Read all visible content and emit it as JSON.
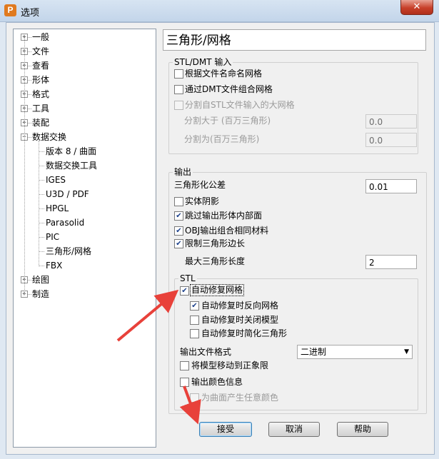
{
  "window": {
    "icon_letter": "P",
    "title": "选项",
    "close_glyph": "✕"
  },
  "tree": {
    "items": [
      {
        "label": "一般",
        "expander": "+"
      },
      {
        "label": "文件",
        "expander": "+"
      },
      {
        "label": "查看",
        "expander": "+"
      },
      {
        "label": "形体",
        "expander": "+"
      },
      {
        "label": "格式",
        "expander": "+"
      },
      {
        "label": "工具",
        "expander": "+"
      },
      {
        "label": "装配",
        "expander": "+"
      },
      {
        "label": "数据交换",
        "expander": "−"
      },
      {
        "label": "版本 8 / 曲面"
      },
      {
        "label": "数据交换工具"
      },
      {
        "label": "IGES"
      },
      {
        "label": "U3D / PDF"
      },
      {
        "label": "HPGL"
      },
      {
        "label": "Parasolid"
      },
      {
        "label": "PIC"
      },
      {
        "label": "三角形/网格",
        "selected": true
      },
      {
        "label": "FBX"
      },
      {
        "label": "绘图",
        "expander": "+"
      },
      {
        "label": "制造",
        "expander": "+"
      }
    ]
  },
  "panel": {
    "title": "三角形/网格",
    "import_group": {
      "title": "STL/DMT 输入",
      "name_by_file": {
        "label": "根据文件名命名网格",
        "checked": false
      },
      "combine_dmt": {
        "label": "通过DMT文件组合网格",
        "checked": false
      },
      "split_large": {
        "label": "分割自STL文件输入的大网格",
        "checked": false,
        "enabled": false
      },
      "split_above": {
        "label": "分割大于 (百万三角形)",
        "value": "0.0"
      },
      "split_into": {
        "label": "分割为(百万三角形)",
        "value": "0.0"
      }
    },
    "output_group": {
      "title": "输出",
      "tolerance": {
        "label": "三角形化公差",
        "value": "0.01"
      },
      "solid_shading": {
        "label": "实体阴影",
        "checked": false
      },
      "skip_internal": {
        "label": "跳过输出形体内部面",
        "checked": true
      },
      "obj_combine": {
        "label": "OBJ输出组合相同材料",
        "checked": true
      },
      "limit_edge": {
        "label": "限制三角形边长",
        "checked": true
      },
      "max_edge": {
        "label": "最大三角形长度",
        "value": "2"
      },
      "stl": {
        "title": "STL",
        "auto_repair": {
          "label": "自动修复网格",
          "checked": true
        },
        "reverse": {
          "label": "自动修复时反向网格",
          "checked": true
        },
        "close_model": {
          "label": "自动修复时关闭模型",
          "checked": false
        },
        "simplify": {
          "label": "自动修复时简化三角形",
          "checked": false
        },
        "format_label": "输出文件格式",
        "format_value": "二进制",
        "move_positive": {
          "label": "将模型移动到正象限",
          "checked": false
        },
        "export_color": {
          "label": "输出颜色信息",
          "checked": false
        },
        "surface_color": {
          "label": "为曲面产生任意颜色",
          "checked": false,
          "enabled": false
        }
      }
    }
  },
  "buttons": {
    "accept": "接受",
    "cancel": "取消",
    "help": "帮助"
  },
  "colors": {
    "annotation_arrow": "#e8413a"
  }
}
